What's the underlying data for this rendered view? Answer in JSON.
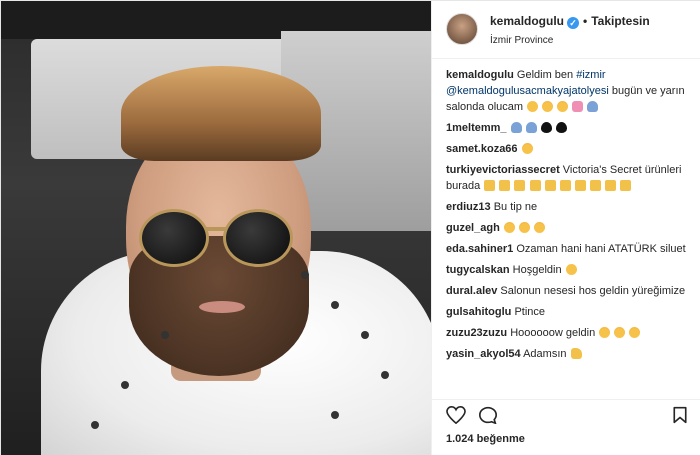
{
  "header": {
    "username": "kemaldogulu",
    "follow_label": "Takiptesin",
    "dot": "•",
    "location": "İzmir Province"
  },
  "comments": [
    {
      "user": "kemaldogulu",
      "text_a": "Geldim ben ",
      "tag1": "#izmir",
      "tag2": "@kemaldogulusacmakyajatolyesi",
      "text_b": " bugün ve yarın salonda olucam",
      "emojis": [
        "grin",
        "heart-eyes",
        "heart-eyes",
        "love",
        "person"
      ]
    },
    {
      "user": "1meltemm_",
      "text": "",
      "emojis": [
        "person",
        "person",
        "blk-heart",
        "blk-heart"
      ]
    },
    {
      "user": "samet.koza66",
      "text": "",
      "emojis": [
        "heart-eyes"
      ]
    },
    {
      "user": "turkiyevictoriassecret",
      "text": "Victoria's Secret ürünleri burada",
      "emojis": [
        "point",
        "point",
        "point",
        "point",
        "point",
        "point",
        "point",
        "point",
        "point",
        "point"
      ]
    },
    {
      "user": "erdiuz13",
      "text": "Bu tip ne",
      "emojis": []
    },
    {
      "user": "guzel_agh",
      "text": "",
      "emojis": [
        "heart-eyes",
        "heart-eyes",
        "heart-eyes"
      ]
    },
    {
      "user": "eda.sahiner1",
      "text": "Ozaman hani hani ATATÜRK siluet",
      "emojis": []
    },
    {
      "user": "tugycalskan",
      "text": "Hoşgeldin",
      "emojis": [
        "grin"
      ]
    },
    {
      "user": "dural.alev",
      "text": "Salonun nesesi hos geldin yüreğimize",
      "emojis": []
    },
    {
      "user": "gulsahitoglu",
      "text": "Ptince",
      "emojis": []
    },
    {
      "user": "zuzu23zuzu",
      "text": "Hoooooow geldin",
      "emojis": [
        "heart-eyes",
        "heart-eyes",
        "heart-eyes"
      ]
    },
    {
      "user": "yasin_akyol54",
      "text": "Adamsın",
      "emojis": [
        "muscle"
      ]
    }
  ],
  "likes": "1.024 beğenme",
  "icons": {
    "like": "heart-icon",
    "comment": "comment-bubble-icon",
    "save": "bookmark-icon"
  },
  "colors": {
    "verified": "#3897f0",
    "tag": "#003569"
  }
}
